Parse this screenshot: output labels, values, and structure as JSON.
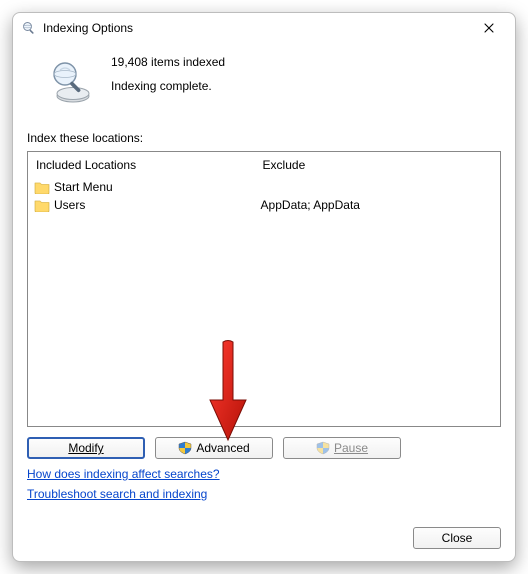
{
  "title": "Indexing Options",
  "status": {
    "count_line": "19,408 items indexed",
    "state_line": "Indexing complete."
  },
  "section_label": "Index these locations:",
  "columns": {
    "included_header": "Included Locations",
    "excluded_header": "Exclude"
  },
  "locations": [
    {
      "name": "Start Menu",
      "exclude": ""
    },
    {
      "name": "Users",
      "exclude": "AppData; AppData"
    }
  ],
  "buttons": {
    "modify": "Modify",
    "advanced": "Advanced",
    "pause": "Pause",
    "close": "Close"
  },
  "links": {
    "how": "How does indexing affect searches?",
    "troubleshoot": "Troubleshoot search and indexing"
  }
}
